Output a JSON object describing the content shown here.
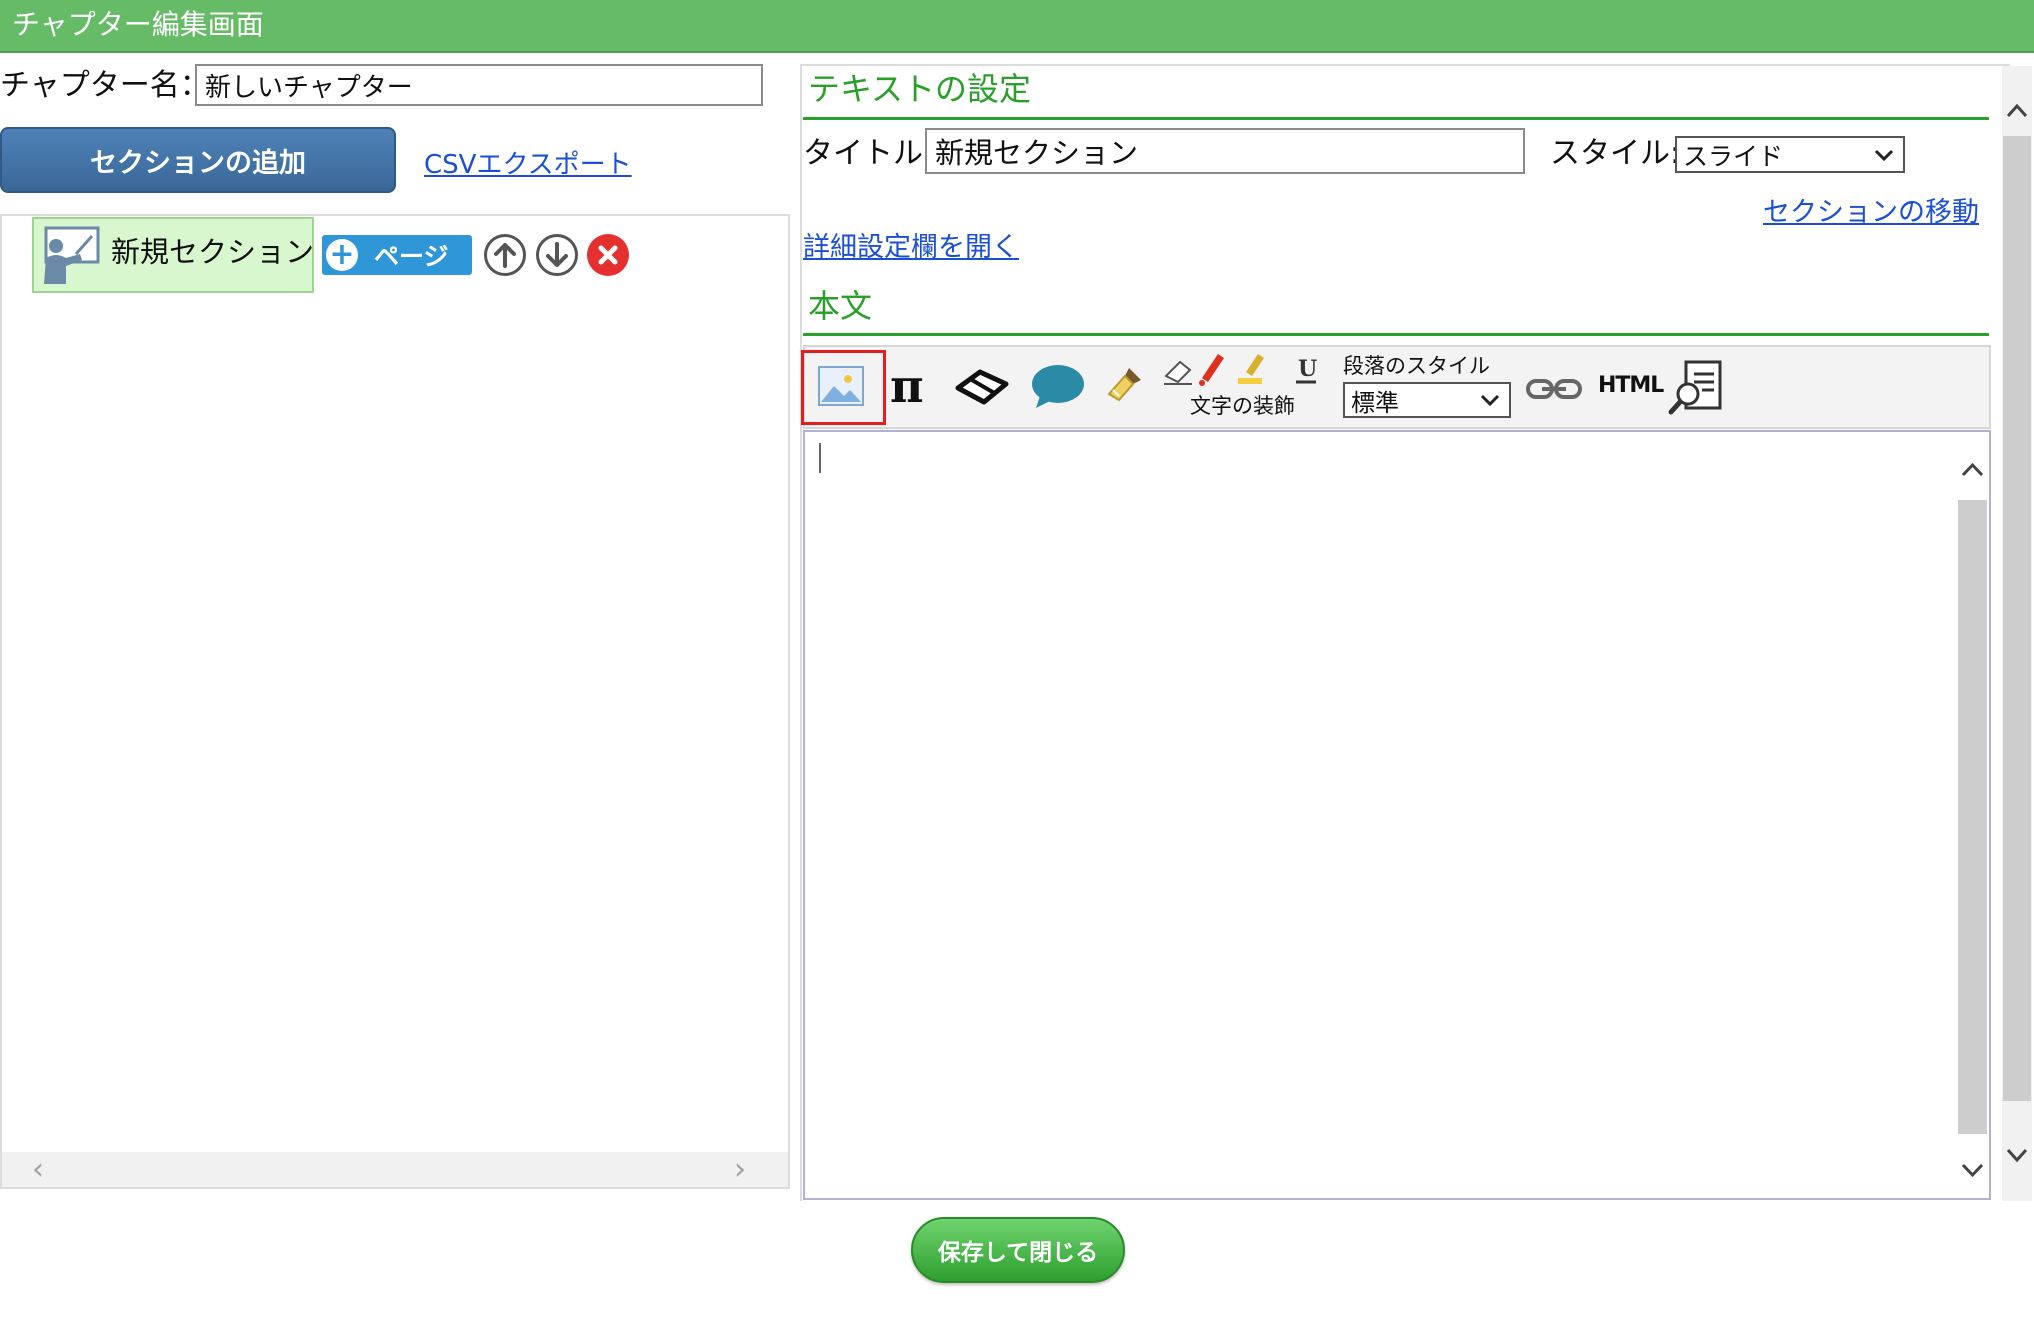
{
  "header": {
    "title": "チャプター編集画面"
  },
  "chapter": {
    "label": "チャプター名：",
    "value": "新しいチャプター"
  },
  "left": {
    "add_section_label": "セクションの追加",
    "csv_export_label": "CSVエクスポート",
    "section_node": {
      "label": "新規セクション",
      "add_page_label": "ページ"
    }
  },
  "text_settings": {
    "heading": "テキストの設定",
    "title_label": "タイトル:",
    "title_value": "新規セクション",
    "style_label": "スタイル:",
    "style_value": "スライド",
    "move_section_label": "セクションの移動",
    "open_advanced_label": "詳細設定欄を開く"
  },
  "body_editor": {
    "heading": "本文",
    "toolbar": {
      "char_decoration_label": "文字の装飾",
      "paragraph_style_label": "段落のスタイル",
      "paragraph_style_value": "標準",
      "html_label": "HTML",
      "pi_label": "π",
      "underline_label": "U"
    },
    "content": ""
  },
  "footer": {
    "save_close_label": "保存して閉じる"
  },
  "colors": {
    "header_bg": "#66bb66",
    "section_title_green": "#2aa02a",
    "primary_button": "#3a6797",
    "link": "#1a4fd6",
    "save_button": "#2e9f2e",
    "highlight_red": "#e02020"
  }
}
